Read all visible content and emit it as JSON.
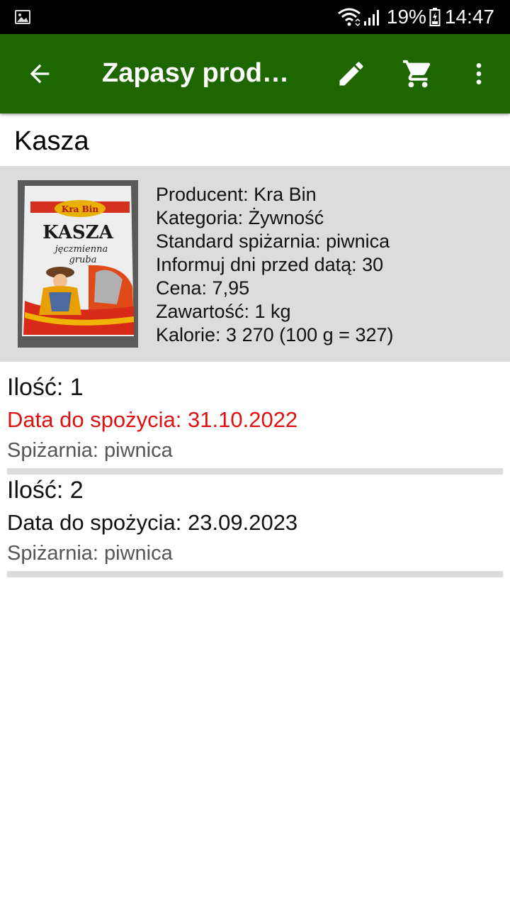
{
  "status_bar": {
    "battery": "19%",
    "time": "14:47"
  },
  "app_bar": {
    "title": "Zapasy produ…"
  },
  "product": {
    "name": "Kasza",
    "image_label_lines": [
      "Kra Bin",
      "KASZA",
      "jęczmienna",
      "gruba"
    ],
    "details": [
      "Producent: Kra Bin",
      "Kategoria: Żywność",
      "Standard spiżarnia: piwnica",
      "Informuj dni przed datą: 30",
      "Cena: 7,95",
      "Zawartość: 1 kg",
      "Kalorie: 3 270 (100 g = 327)"
    ]
  },
  "stock": [
    {
      "quantity": "Ilość: 1",
      "expiry": "Data do spożycia: 31.10.2022",
      "pantry": "Spiżarnia: piwnica"
    },
    {
      "quantity": "Ilość: 2",
      "expiry": "Data do spożycia: 23.09.2023",
      "pantry": "Spiżarnia: piwnica"
    }
  ],
  "colors": {
    "app_bar": "#1e6600",
    "expired_text": "#dd1111",
    "panel_background": "#dcdcdc"
  }
}
